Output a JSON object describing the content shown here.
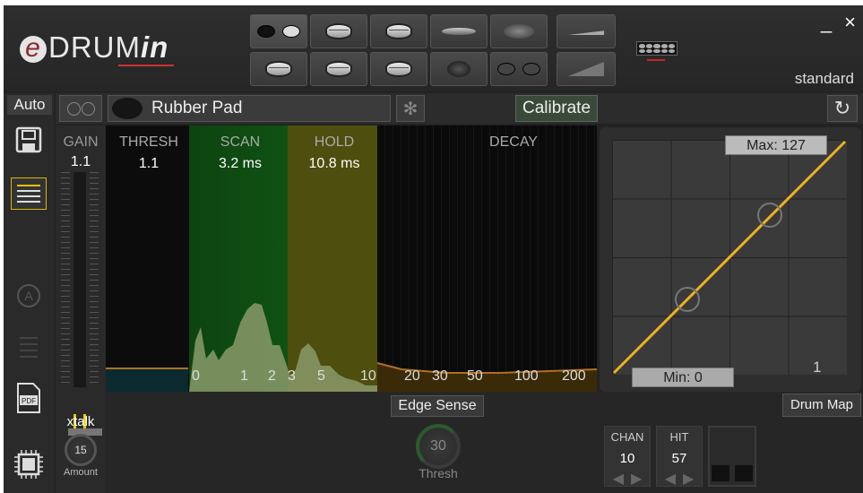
{
  "header": {
    "logo_e": "e",
    "logo_drum": "DRUM",
    "logo_in": "in",
    "preset": "standard",
    "minimize": "_",
    "close": "×"
  },
  "pads_row1": [
    "dual-pad-selected",
    "tom",
    "tom",
    "crash-cymbal-top",
    "ride-cymbal",
    "hihat-pedal"
  ],
  "pads_row2": [
    "snare",
    "tom",
    "tom",
    "crash-cymbal",
    "dual-pad",
    "hihat-pedal-full"
  ],
  "sidebar": {
    "auto": "Auto"
  },
  "toolbar": {
    "pad_name": "Rubber Pad",
    "calibrate": "Calibrate"
  },
  "gain": {
    "label": "GAIN",
    "value": "1.1",
    "xtalk": "xtalk",
    "amount_value": "15",
    "amount_label": "Amount"
  },
  "graph": {
    "thresh": {
      "label": "THRESH",
      "value": "1.1"
    },
    "scan": {
      "label": "SCAN",
      "value": "3.2 ms"
    },
    "hold": {
      "label": "HOLD",
      "value": "10.8 ms"
    },
    "decay": {
      "label": "DECAY"
    },
    "ticks": [
      "0",
      "1",
      "2",
      "3",
      "5",
      "10",
      "20",
      "30",
      "50",
      "100",
      "200"
    ]
  },
  "curve": {
    "max": "Max: 127",
    "min": "Min: 0",
    "layer": "1"
  },
  "bottom": {
    "edge_sense": "Edge Sense",
    "thresh_value": "30",
    "thresh_label": "Thresh",
    "drum_map": "Drum Map",
    "chan_label": "CHAN",
    "chan_value": "10",
    "hit_label": "HIT",
    "hit_value": "57"
  },
  "colors": {
    "scan": "#0e4a0e",
    "hold": "#5a5a10",
    "curve": "#f0b020",
    "decay": "#3a2a08"
  }
}
